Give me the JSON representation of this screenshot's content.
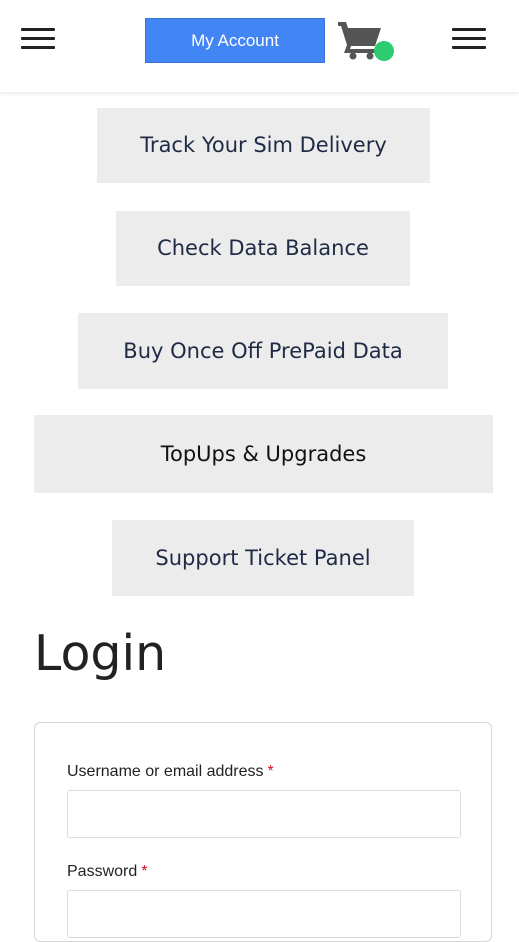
{
  "header": {
    "account_label": "My Account",
    "account_color": "#4285f4",
    "cart_badge_color": "#2ecc71",
    "left_menu_icon": "hamburger-icon",
    "right_menu_icon": "hamburger-icon",
    "cart_icon": "shopping-cart-icon"
  },
  "nav_buttons": [
    {
      "label": "Track Your Sim Delivery"
    },
    {
      "label": "Check Data Balance"
    },
    {
      "label": "Buy Once Off PrePaid Data"
    },
    {
      "label": "TopUps & Upgrades"
    },
    {
      "label": "Support Ticket Panel"
    }
  ],
  "login": {
    "title": "Login",
    "username_label": "Username or email address",
    "username_value": "",
    "password_label": "Password",
    "password_value": "",
    "required_marker": "*"
  }
}
